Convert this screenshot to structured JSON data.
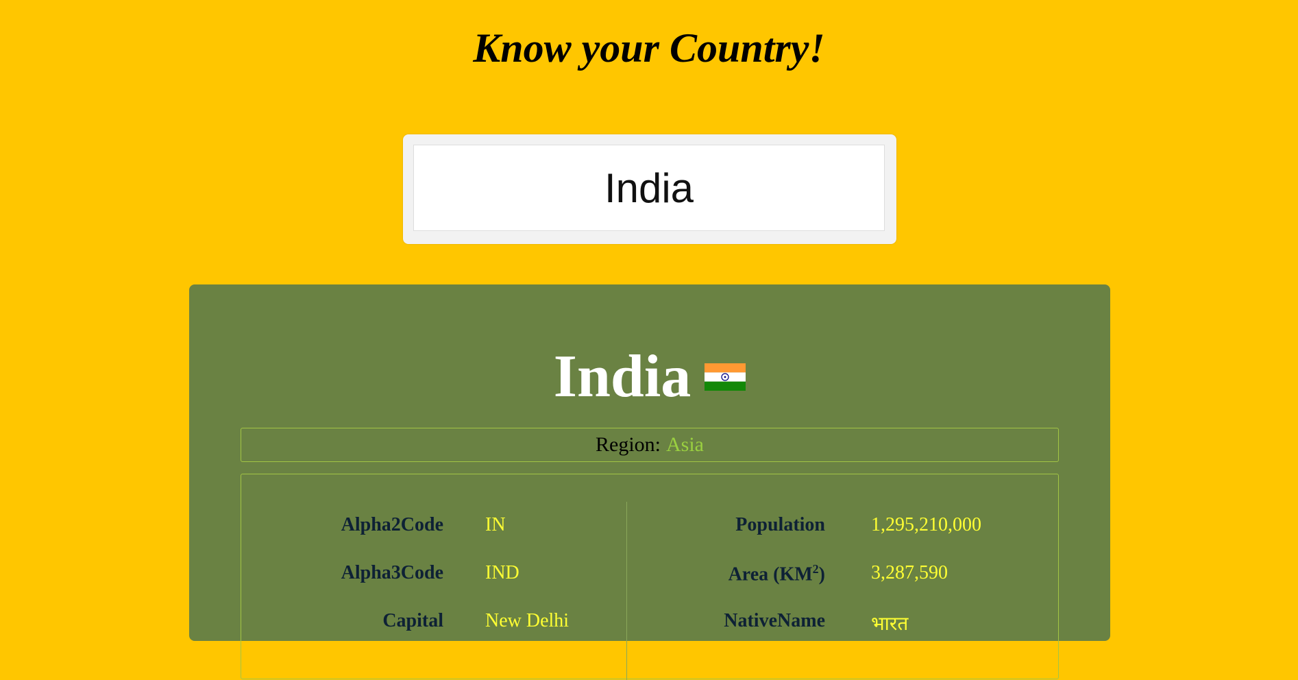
{
  "page": {
    "title": "Know your Country!"
  },
  "search": {
    "value": "India"
  },
  "country": {
    "name": "India",
    "flag_icon": "india-flag-icon",
    "region_label": "Region:",
    "region_value": "Asia"
  },
  "details": {
    "left": [
      {
        "label": "Alpha2Code",
        "value": "IN"
      },
      {
        "label": "Alpha3Code",
        "value": "IND"
      },
      {
        "label": "Capital",
        "value": "New Delhi"
      }
    ],
    "right": [
      {
        "label": "Population",
        "value": "1,295,210,000"
      },
      {
        "label": "Area (KM",
        "label_sup": "2",
        "label_suffix": ")",
        "value": "3,287,590"
      },
      {
        "label": "NativeName",
        "value": "भारत"
      }
    ]
  },
  "colors": {
    "background": "#ffc600",
    "card": "#6a8243",
    "value_text": "#ffff33",
    "region_value": "#9ad040",
    "label_text": "#0e2135"
  }
}
